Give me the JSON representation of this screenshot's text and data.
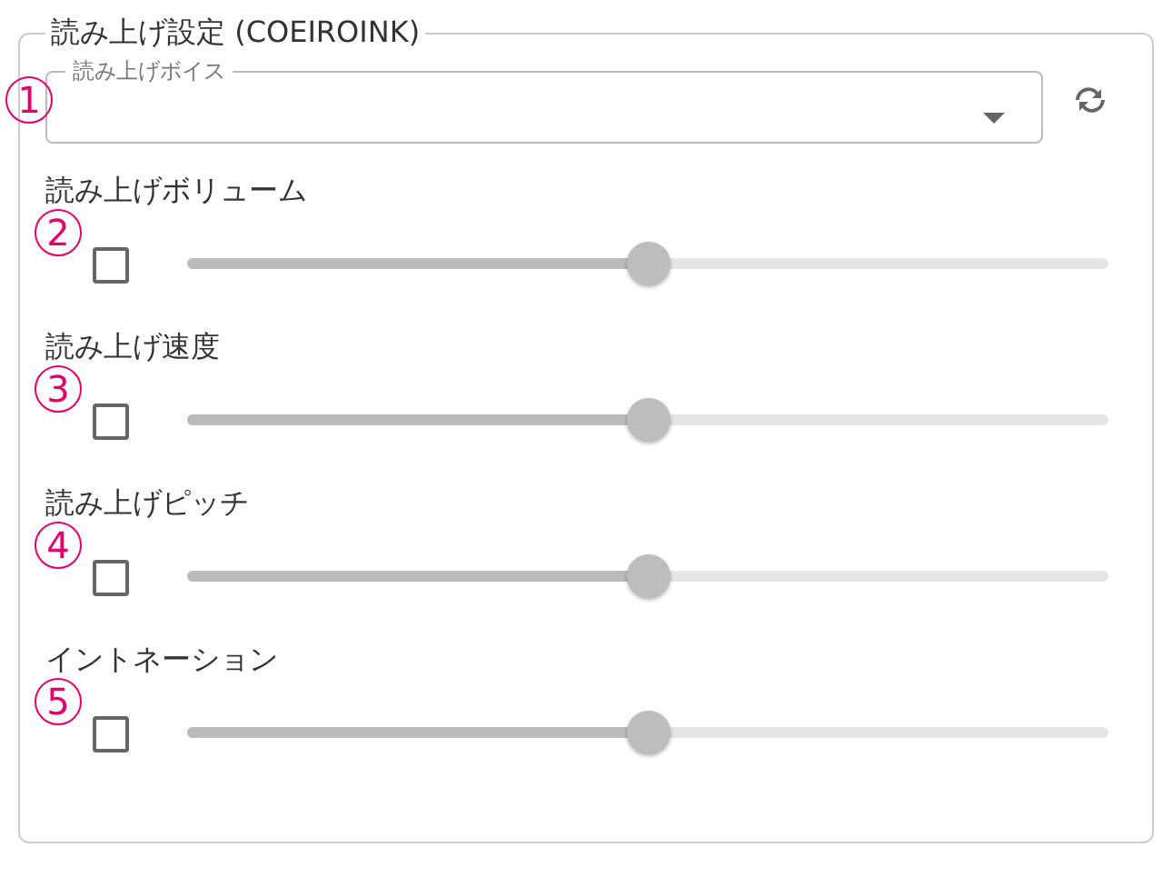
{
  "group": {
    "title": "読み上げ設定 (COEIROINK)",
    "voice_select": {
      "label": "読み上げボイス",
      "marker": "1"
    },
    "sliders": [
      {
        "label": "読み上げボリューム",
        "marker": "2",
        "checked": false,
        "level": 0.5
      },
      {
        "label": "読み上げ速度",
        "marker": "3",
        "checked": false,
        "level": 0.5
      },
      {
        "label": "読み上げピッチ",
        "marker": "4",
        "checked": false,
        "level": 0.5
      },
      {
        "label": "イントネーション",
        "marker": "5",
        "checked": false,
        "level": 0.5
      }
    ]
  }
}
